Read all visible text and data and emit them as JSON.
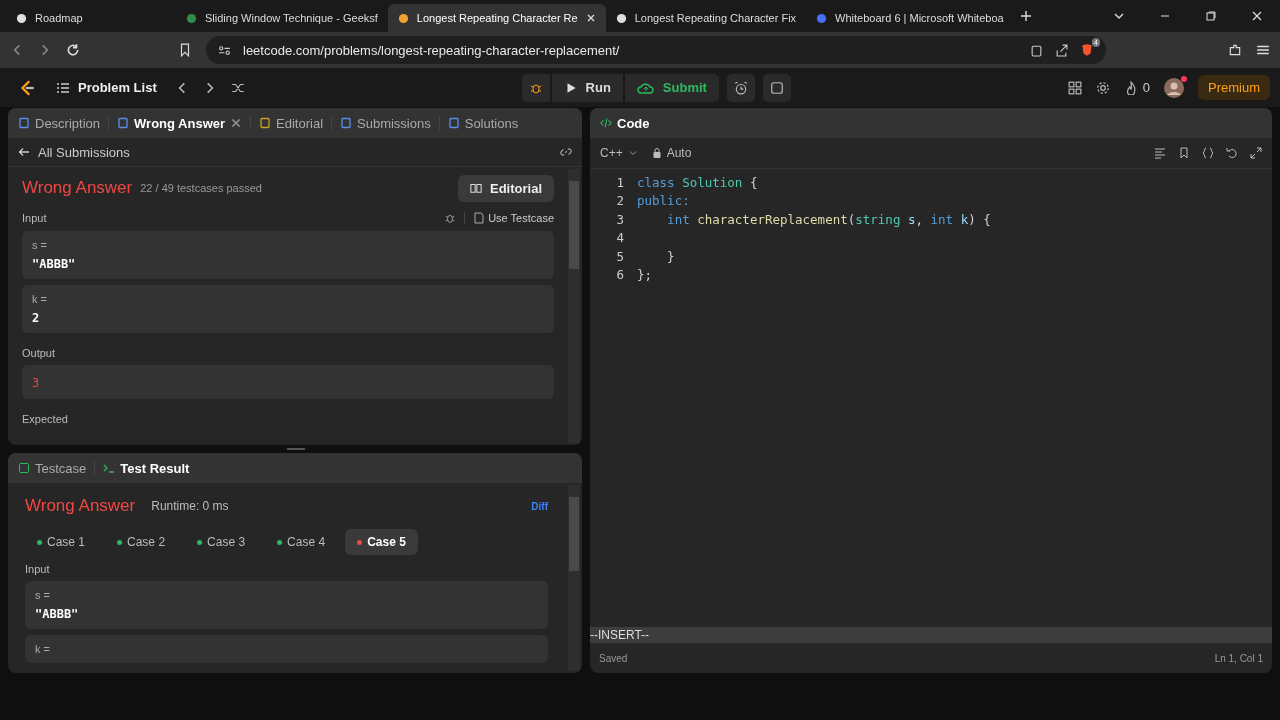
{
  "browser": {
    "tabs": [
      {
        "title": "Roadmap",
        "selected": false
      },
      {
        "title": "Sliding Window Technique - Geeksf",
        "selected": false
      },
      {
        "title": "Longest Repeating Character Re",
        "selected": true
      },
      {
        "title": "Longest Repeating Character Fix",
        "selected": false
      },
      {
        "title": "Whiteboard 6 | Microsoft Whiteboa",
        "selected": false
      }
    ],
    "url": "leetcode.com/problems/longest-repeating-character-replacement/",
    "shield_badge": "4"
  },
  "header": {
    "problem_list": "Problem List",
    "run": "Run",
    "submit": "Submit",
    "streak": "0",
    "premium": "Premium"
  },
  "description_panel": {
    "tabs": [
      {
        "label": "Description",
        "selected": false,
        "closable": false
      },
      {
        "label": "Wrong Answer",
        "selected": true,
        "closable": true
      },
      {
        "label": "Editorial",
        "selected": false,
        "closable": false
      },
      {
        "label": "Submissions",
        "selected": false,
        "closable": false
      },
      {
        "label": "Solutions",
        "selected": false,
        "closable": false
      }
    ],
    "back_link": "All Submissions",
    "status": "Wrong Answer",
    "passed": "22 / 49 testcases passed",
    "editorial_button": "Editorial",
    "input_label": "Input",
    "use_testcase": "Use Testcase",
    "inputs": [
      {
        "name": "s =",
        "value": "\"ABBB\""
      },
      {
        "name": "k =",
        "value": "2"
      }
    ],
    "output_label": "Output",
    "output": "3",
    "expected_label": "Expected"
  },
  "result_panel": {
    "tabs": [
      {
        "label": "Testcase",
        "selected": false
      },
      {
        "label": "Test Result",
        "selected": true
      }
    ],
    "status": "Wrong Answer",
    "runtime": "Runtime: 0 ms",
    "diff": "Diff",
    "cases": [
      {
        "label": "Case 1",
        "selected": false,
        "color": "#2cbb5d"
      },
      {
        "label": "Case 2",
        "selected": false,
        "color": "#2cbb5d"
      },
      {
        "label": "Case 3",
        "selected": false,
        "color": "#2cbb5d"
      },
      {
        "label": "Case 4",
        "selected": false,
        "color": "#2cbb5d"
      },
      {
        "label": "Case 5",
        "selected": true,
        "color": "#ef4743"
      }
    ],
    "input_label": "Input",
    "inputs": [
      {
        "name": "s =",
        "value": "\"ABBB\""
      },
      {
        "name": "k ="
      }
    ]
  },
  "editor": {
    "tab": "Code",
    "language": "C++",
    "mode": "Auto",
    "lines": [
      {
        "number": "1",
        "tokens": [
          {
            "text": "class",
            "kind": "keyword"
          },
          {
            "text": " Solution",
            "kind": "type"
          },
          {
            "text": " {",
            "kind": "plain"
          }
        ]
      },
      {
        "number": "2",
        "tokens": [
          {
            "text": "public:",
            "kind": "keyword"
          }
        ]
      },
      {
        "number": "3",
        "tokens": [
          {
            "text": "    int",
            "kind": "keyword"
          },
          {
            "text": " characterReplacement",
            "kind": "function"
          },
          {
            "text": "(",
            "kind": "plain"
          },
          {
            "text": "string",
            "kind": "type"
          },
          {
            "text": " s",
            "kind": "param"
          },
          {
            "text": ",",
            "kind": "plain"
          },
          {
            "text": " int",
            "kind": "keyword"
          },
          {
            "text": " k",
            "kind": "param"
          },
          {
            "text": ") {",
            "kind": "plain"
          }
        ]
      },
      {
        "number": "4"
      },
      {
        "number": "5",
        "tokens": [
          {
            "text": "    }",
            "kind": "plain"
          }
        ]
      },
      {
        "number": "6",
        "tokens": [
          {
            "text": "};",
            "kind": "plain"
          }
        ]
      }
    ],
    "vim_mode": "--INSERT--",
    "save_status": "Saved",
    "cursor": "Ln 1, Col 1"
  }
}
